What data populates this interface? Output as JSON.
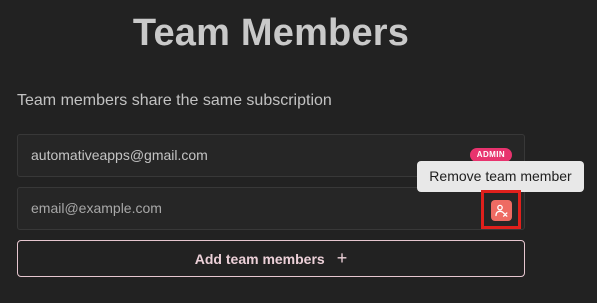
{
  "header": {
    "title": "Team Members",
    "subtitle": "Team members share the same subscription"
  },
  "members": [
    {
      "email": "automativeapps@gmail.com",
      "badge": "ADMIN"
    },
    {
      "email": "email@example.com",
      "action_icon": "remove-user-icon"
    }
  ],
  "tooltip": {
    "text": "Remove team member"
  },
  "add_button": {
    "label": "Add team members",
    "icon": "plus-icon"
  },
  "colors": {
    "background": "#222222",
    "badge": "#e8336e",
    "remove_button": "#ee6b63",
    "highlight": "#e0201c",
    "add_button_border": "#e6c6cf"
  }
}
